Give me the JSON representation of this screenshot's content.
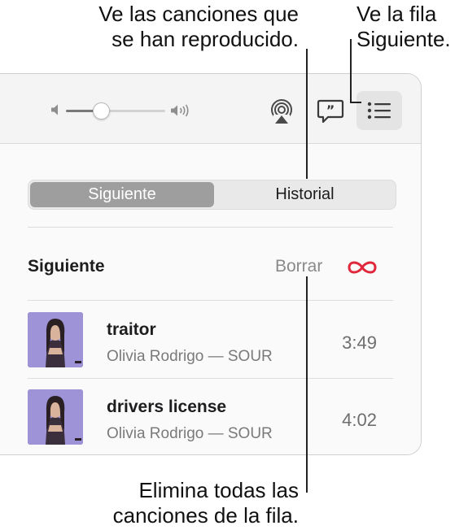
{
  "callouts": {
    "history": [
      "Ve las canciones que",
      "se han reproducido."
    ],
    "upnext": [
      "Ve la fila",
      "Siguiente."
    ],
    "clear": [
      "Elimina todas las",
      "canciones de la fila."
    ]
  },
  "toolbar": {
    "volume_level": 0.35,
    "icons": [
      "speaker-low-icon",
      "speaker-high-icon",
      "airplay-icon",
      "lyrics-icon",
      "up-next-list-icon"
    ]
  },
  "segmented": {
    "options": [
      "Siguiente",
      "Historial"
    ],
    "selected": "Siguiente"
  },
  "queue": {
    "title": "Siguiente",
    "clear_label": "Borrar",
    "songs": [
      {
        "title": "traitor",
        "subtitle": "Olivia Rodrigo — SOUR",
        "duration": "3:49"
      },
      {
        "title": "drivers license",
        "subtitle": "Olivia Rodrigo — SOUR",
        "duration": "4:02"
      }
    ]
  },
  "colors": {
    "accent": "#e0283c",
    "segment_active": "#9e9e9e",
    "artwork_bg": "#9d93d6"
  }
}
